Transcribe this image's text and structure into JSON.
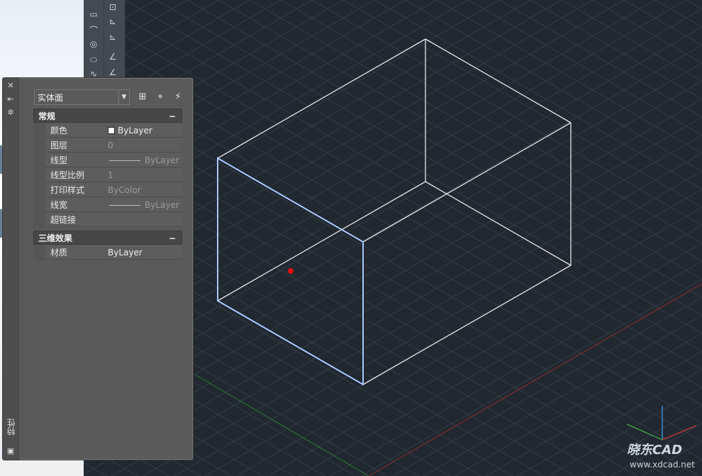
{
  "palette": {
    "title": "特性",
    "object_type": "实体面",
    "sections": [
      {
        "label": "常规",
        "collapse": "−",
        "rows": [
          {
            "name": "颜色",
            "value": "ByLayer"
          },
          {
            "name": "图层",
            "value": "0"
          },
          {
            "name": "线型",
            "value": "ByLayer"
          },
          {
            "name": "线型比例",
            "value": "1"
          },
          {
            "name": "打印样式",
            "value": "ByColor"
          },
          {
            "name": "线宽",
            "value": "ByLayer"
          },
          {
            "name": "超链接",
            "value": ""
          }
        ]
      },
      {
        "label": "三维效果",
        "collapse": "−",
        "rows": [
          {
            "name": "材质",
            "value": "ByLayer"
          }
        ]
      }
    ]
  },
  "icons": {
    "close": "close-icon",
    "autohide": "autohide-icon",
    "settings": "settings-icon",
    "quick_select": "quick-select-icon",
    "select_objects": "select-objects-icon",
    "pickadd": "pickadd-toggle-icon"
  },
  "colors": {
    "viewport_bg": "#212830",
    "wire": "#e6e6e6",
    "selected_face": "#8fb4ff",
    "x_axis": "#b03a3a",
    "y_axis": "#3fa04a",
    "z_axis": "#3a8fd0"
  },
  "watermark": {
    "logo": "晓东CAD",
    "url": "www.xdcad.net"
  }
}
